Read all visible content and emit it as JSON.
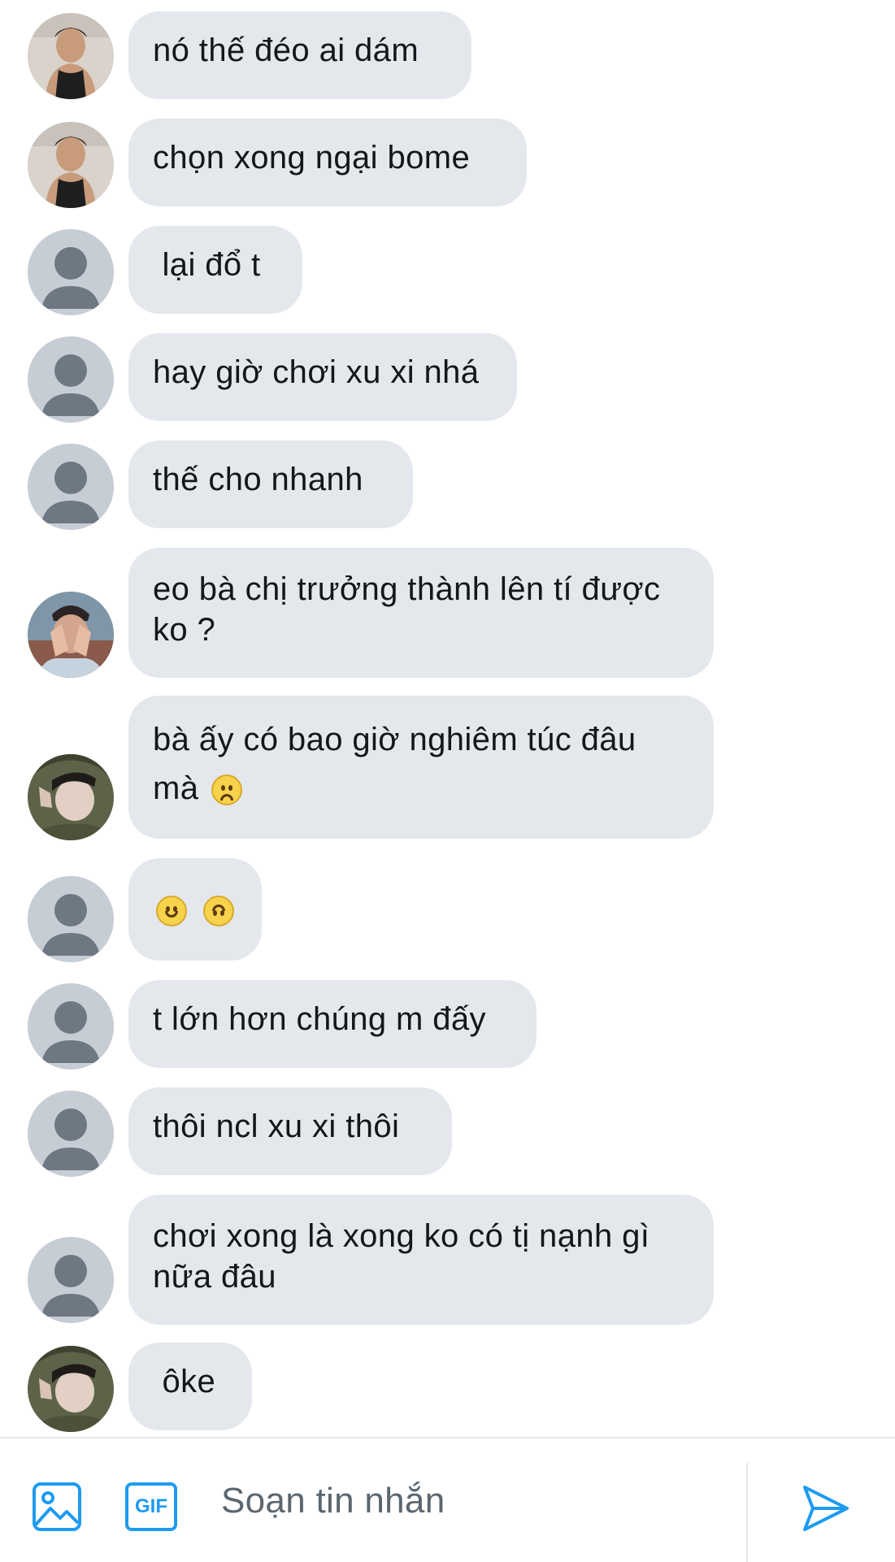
{
  "colors": {
    "bubble_bg": "#e4e8ed",
    "text": "#14171a",
    "accent": "#1d9bf0",
    "placeholder": "#5b6770",
    "default_avatar_bg": "#c7cdd4",
    "default_avatar_fg": "#6e7883"
  },
  "messages": [
    {
      "avatar": "photo-boy-tanktop-avatar",
      "text": "nó thế đéo ai dám"
    },
    {
      "avatar": "photo-boy-tanktop-avatar",
      "text": "chọn xong ngại bome"
    },
    {
      "avatar": "default-user-avatar",
      "text": " lại đổ t"
    },
    {
      "avatar": "default-user-avatar",
      "text": "hay giờ chơi xu xi nhá"
    },
    {
      "avatar": "default-user-avatar",
      "text": "thế cho nhanh"
    },
    {
      "avatar": "photo-hands-face-avatar",
      "line1": "eo bà chị trưởng thành lên tí được",
      "line2": "ko ?"
    },
    {
      "avatar": "photo-girl-hood-avatar",
      "line1": "bà ấy có bao giờ nghiêm túc đâu",
      "line2": "mà",
      "emoji": "slightly-frowning-face"
    },
    {
      "avatar": "default-user-avatar",
      "emojis": [
        "slightly-smiling-face",
        "upside-down-face"
      ]
    },
    {
      "avatar": "default-user-avatar",
      "text": "t lớn hơn chúng m đấy"
    },
    {
      "avatar": "default-user-avatar",
      "text": "thôi ncl xu xi thôi"
    },
    {
      "avatar": "default-user-avatar",
      "line1": "chơi xong là xong ko có tị nạnh gì",
      "line2": "nữa đâu"
    },
    {
      "avatar": "photo-girl-hood-avatar",
      "text": " ôke"
    }
  ],
  "composer": {
    "image_icon": "image-icon",
    "gif_label": "GIF",
    "placeholder": "Soạn tin nhắn",
    "send_icon": "send-icon"
  }
}
